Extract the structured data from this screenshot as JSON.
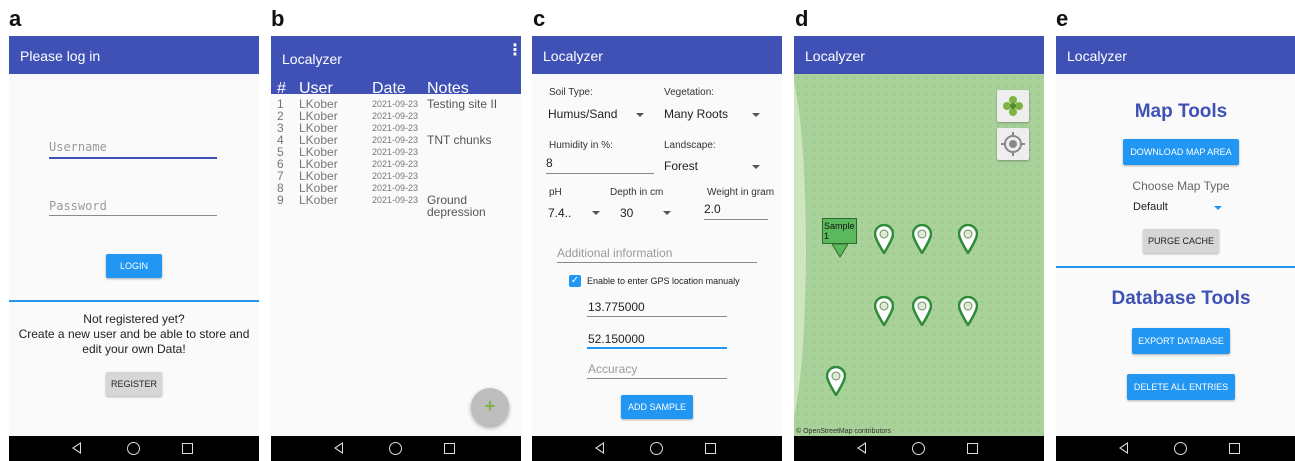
{
  "panels": {
    "a": {
      "label": "a",
      "title": "Please log in",
      "username_placeholder": "Username",
      "password_placeholder": "Password",
      "login_label": "LOGIN",
      "not_registered": "Not registered yet?",
      "register_info_1": "Create a new user and be able to store and",
      "register_info_2": "edit your own Data!",
      "register_label": "REGISTER"
    },
    "b": {
      "label": "b",
      "title": "Localyzer",
      "menu_icon": "more-vert-icon",
      "headers": [
        "#",
        "User",
        "Date",
        "Notes"
      ],
      "rows": [
        {
          "n": "1",
          "user": "LKober",
          "date": "2021-09-23",
          "notes": "Testing site II"
        },
        {
          "n": "2",
          "user": "LKober",
          "date": "2021-09-23",
          "notes": ""
        },
        {
          "n": "3",
          "user": "LKober",
          "date": "2021-09-23",
          "notes": ""
        },
        {
          "n": "4",
          "user": "LKober",
          "date": "2021-09-23",
          "notes": "TNT chunks"
        },
        {
          "n": "5",
          "user": "LKober",
          "date": "2021-09-23",
          "notes": ""
        },
        {
          "n": "6",
          "user": "LKober",
          "date": "2021-09-23",
          "notes": ""
        },
        {
          "n": "7",
          "user": "LKober",
          "date": "2021-09-23",
          "notes": ""
        },
        {
          "n": "8",
          "user": "LKober",
          "date": "2021-09-23",
          "notes": ""
        },
        {
          "n": "9",
          "user": "LKober",
          "date": "2021-09-23",
          "notes": "Ground depression"
        }
      ],
      "fab_icon": "plus-icon"
    },
    "c": {
      "label": "c",
      "title": "Localyzer",
      "soil_label": "Soil Type:",
      "soil_value": "Humus/Sand",
      "vegetation_label": "Vegetation:",
      "vegetation_value": "Many Roots",
      "humidity_label": "Humidity in %:",
      "humidity_value": "8",
      "landscape_label": "Landscape:",
      "landscape_value": "Forest",
      "ph_label": "pH",
      "ph_value": "7.4..",
      "depth_label": "Depth in cm",
      "depth_value": "30",
      "weight_label": "Weight in gram",
      "weight_value": "2.0",
      "additional_placeholder": "Additional information",
      "gps_checkbox_label": "Enable to enter GPS location manualy",
      "gps_checked": true,
      "longitude": "13.775000",
      "latitude": "52.150000",
      "accuracy_placeholder": "Accuracy",
      "add_sample_label": "ADD SAMPLE"
    },
    "d": {
      "label": "d",
      "title": "Localyzer",
      "marker_label": "Sample 1",
      "attribution": "© OpenStreetMap contributors",
      "layers_icon": "layers-icon",
      "locate_icon": "my-location-icon"
    },
    "e": {
      "label": "e",
      "title": "Localyzer",
      "map_tools_heading": "Map Tools",
      "download_label": "DOWNLOAD MAP AREA",
      "map_type_label": "Choose Map Type",
      "map_type_value": "Default",
      "purge_label": "PURGE CACHE",
      "database_tools_heading": "Database Tools",
      "export_label": "EXPORT DATABASE",
      "delete_label": "DELETE ALL ENTRIES"
    }
  },
  "colors": {
    "app_bar": "#3f51b5",
    "accent_button": "#2196f3",
    "map_green": "#a9d19a",
    "pin_green": "#2e8b3a"
  }
}
